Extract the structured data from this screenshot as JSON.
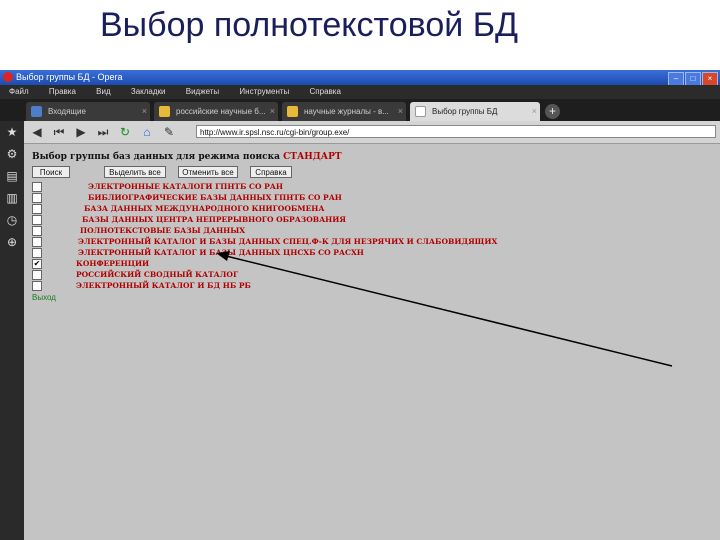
{
  "slide": {
    "title": "Выбор полнотекстовой БД"
  },
  "window": {
    "title": "Выбор группы БД - Opera",
    "menu": [
      "Файл",
      "Правка",
      "Вид",
      "Закладки",
      "Виджеты",
      "Инструменты",
      "Справка"
    ],
    "tabs": [
      {
        "label": "Входящие"
      },
      {
        "label": "российские научные б..."
      },
      {
        "label": "научные журналы - в..."
      },
      {
        "label": "Выбор группы БД"
      }
    ],
    "url": "http://www.ir.spsl.nsc.ru/cgi-bin/group.exe/"
  },
  "page": {
    "heading_prefix": "Выбор группы баз данных для режима поиска",
    "heading_mode": "СТАНДАРТ",
    "buttons": {
      "search": "Поиск",
      "select_all": "Выделить все",
      "deselect_all": "Отменить все",
      "help": "Справка"
    },
    "databases": [
      {
        "label": "ЭЛЕКТРОННЫЕ КАТАЛОГИ ГПНТБ СО РАН",
        "checked": false
      },
      {
        "label": "БИБЛИОГРАФИЧЕСКИЕ БАЗЫ ДАННЫХ ГПНТБ СО РАН",
        "checked": false
      },
      {
        "label": "БАЗА ДАННЫХ МЕЖДУНАРОДНОГО КНИГООБМЕНА",
        "checked": false
      },
      {
        "label": "БАЗЫ ДАННЫХ ЦЕНТРА НЕПРЕРЫВНОГО ОБРАЗОВАНИЯ",
        "checked": false
      },
      {
        "label": "ПОЛНОТЕКСТОВЫЕ БАЗЫ ДАННЫХ",
        "checked": false
      },
      {
        "label": "ЭЛЕКТРОННЫЙ КАТАЛОГ И БАЗЫ ДАННЫХ СПЕЦ.Ф-К ДЛЯ НЕЗРЯЧИХ И СЛАБОВИДЯЩИХ",
        "checked": false
      },
      {
        "label": "ЭЛЕКТРОННЫЙ КАТАЛОГ И БАЗЫ ДАННЫХ ЦНСХБ СО РАСХН",
        "checked": false
      },
      {
        "label": "КОНФЕРЕНЦИИ",
        "checked": true
      },
      {
        "label": "РОССИЙСКИЙ СВОДНЫЙ КАТАЛОГ",
        "checked": false
      },
      {
        "label": "ЭЛЕКТРОННЫЙ КАТАЛОГ И БД НБ РБ",
        "checked": false
      }
    ],
    "exit_label": "Выход"
  },
  "colors": {
    "db_label": "#b00000",
    "exit_link": "#1a7a1a",
    "slide_title": "#1a1f5c"
  }
}
